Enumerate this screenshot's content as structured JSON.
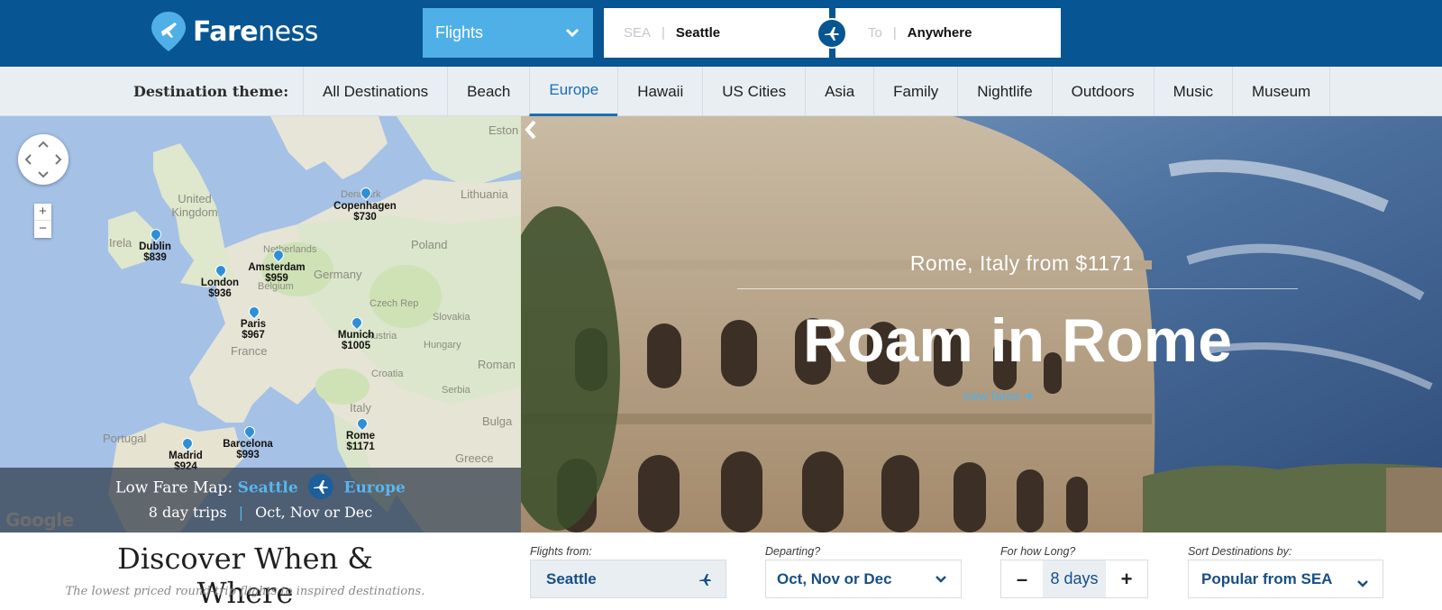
{
  "header": {
    "logo_text_bold": "Fare",
    "logo_text_light": "ness",
    "mode": "Flights",
    "from_code": "SEA",
    "from_value": "Seattle",
    "to_placeholder": "To",
    "to_value": "Anywhere"
  },
  "themes": {
    "label": "Destination theme:",
    "tabs": [
      "All Destinations",
      "Beach",
      "Europe",
      "Hawaii",
      "US Cities",
      "Asia",
      "Family",
      "Nightlife",
      "Outdoors",
      "Music",
      "Museum"
    ],
    "active": "Europe"
  },
  "map": {
    "country_labels": [
      "Eston",
      "United Kingdom",
      "Belgium",
      "Irela",
      "Denmark",
      "Lithuania",
      "Netherlands",
      "Poland",
      "Germany",
      "Czech Rep",
      "Slovakia",
      "Austria",
      "Hungary",
      "France",
      "Croatia",
      "Roman",
      "Serbia",
      "Italy",
      "Bulga",
      "Portugal",
      "Greece"
    ],
    "cities": [
      {
        "name": "Copenhagen",
        "price": "$730"
      },
      {
        "name": "Dublin",
        "price": "$839"
      },
      {
        "name": "Amsterdam",
        "price": "$959"
      },
      {
        "name": "London",
        "price": "$936"
      },
      {
        "name": "Paris",
        "price": "$967"
      },
      {
        "name": "Munich",
        "price": "$1005"
      },
      {
        "name": "Rome",
        "price": "$1171"
      },
      {
        "name": "Barcelona",
        "price": "$993"
      },
      {
        "name": "Madrid",
        "price": "$924"
      }
    ],
    "overlay": {
      "label": "Low Fare Map:",
      "origin": "Seattle",
      "destination": "Europe",
      "trip_length": "8 day trips",
      "months": "Oct, Nov or Dec"
    },
    "attribution": "Google"
  },
  "hero": {
    "subtitle": "Rome, Italy from $1171",
    "title": "Roam in Rome",
    "link": "view fares"
  },
  "search": {
    "title": "Discover When & Where",
    "subtitle": "The lowest priced round-trip flights to inspired destinations.",
    "from_label": "Flights from:",
    "from_value": "Seattle",
    "departing_label": "Departing?",
    "departing_value": "Oct, Nov or Dec",
    "length_label": "For how Long?",
    "length_value": "8 days",
    "minus": "–",
    "plus": "+",
    "sort_label": "Sort Destinations by:",
    "sort_value": "Popular from SEA"
  },
  "colors": {
    "brand_blue": "#075592",
    "accent_blue": "#4fb0e7",
    "link_blue": "#1a6eb6"
  }
}
